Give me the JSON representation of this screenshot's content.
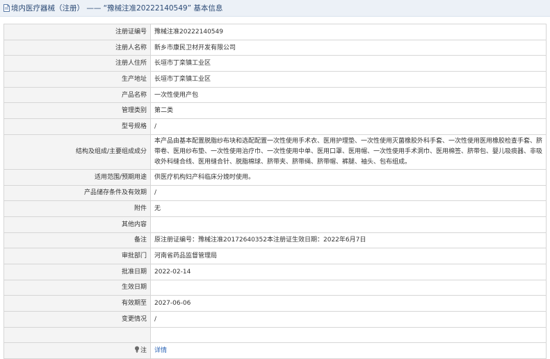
{
  "header": {
    "title": "境内医疗器械（注册） —— “豫械注准20222140549” 基本信息"
  },
  "rows": [
    {
      "label": "注册证编号",
      "value": "豫械注准20222140549"
    },
    {
      "label": "注册人名称",
      "value": "新乡市康民卫材开发有限公司"
    },
    {
      "label": "注册人住所",
      "value": "长垣市丁栾镇工业区"
    },
    {
      "label": "生产地址",
      "value": "长垣市丁栾镇工业区"
    },
    {
      "label": "产品名称",
      "value": "一次性使用产包"
    },
    {
      "label": "管理类别",
      "value": "第二类"
    },
    {
      "label": "型号规格",
      "value": "/"
    },
    {
      "label": "结构及组成/主要组成成分",
      "value": "本产品由基本配置脱脂纱布块和选配配置一次性使用手术衣、医用护理垫、一次性使用灭菌橡胶外科手套、一次性使用医用橡胶检查手套、脐带卷、医用纱布垫、一次性使用治疗巾、一次性使用中单、医用口罩、医用帽、一次性使用手术洞巾、医用棉签、脐带包、婴儿吸痰器、非吸收外科缝合线、医用缝合针、脱脂棉球、脐带夹、脐带绳、脐带帽、裤腿、袖头、包布组成。"
    },
    {
      "label": "适用范围/预期用途",
      "value": "供医疗机构妇产科临床分娩时使用。"
    },
    {
      "label": "产品储存条件及有效期",
      "value": "/"
    },
    {
      "label": "附件",
      "value": "无"
    },
    {
      "label": "其他内容",
      "value": ""
    },
    {
      "label": "备注",
      "value": "原注册证编号：豫械注准20172640352本注册证生效日期：2022年6月7日"
    },
    {
      "label": "审批部门",
      "value": "河南省药品监督管理局"
    },
    {
      "label": "批准日期",
      "value": "2022-02-14"
    },
    {
      "label": "生效日期",
      "value": ""
    },
    {
      "label": "有效期至",
      "value": "2027-06-06"
    },
    {
      "label": "变更情况",
      "value": "/"
    }
  ],
  "note_row": {
    "label": "注",
    "link": "详情"
  },
  "icons": {
    "header": "document-icon",
    "note": "bulb-icon"
  }
}
